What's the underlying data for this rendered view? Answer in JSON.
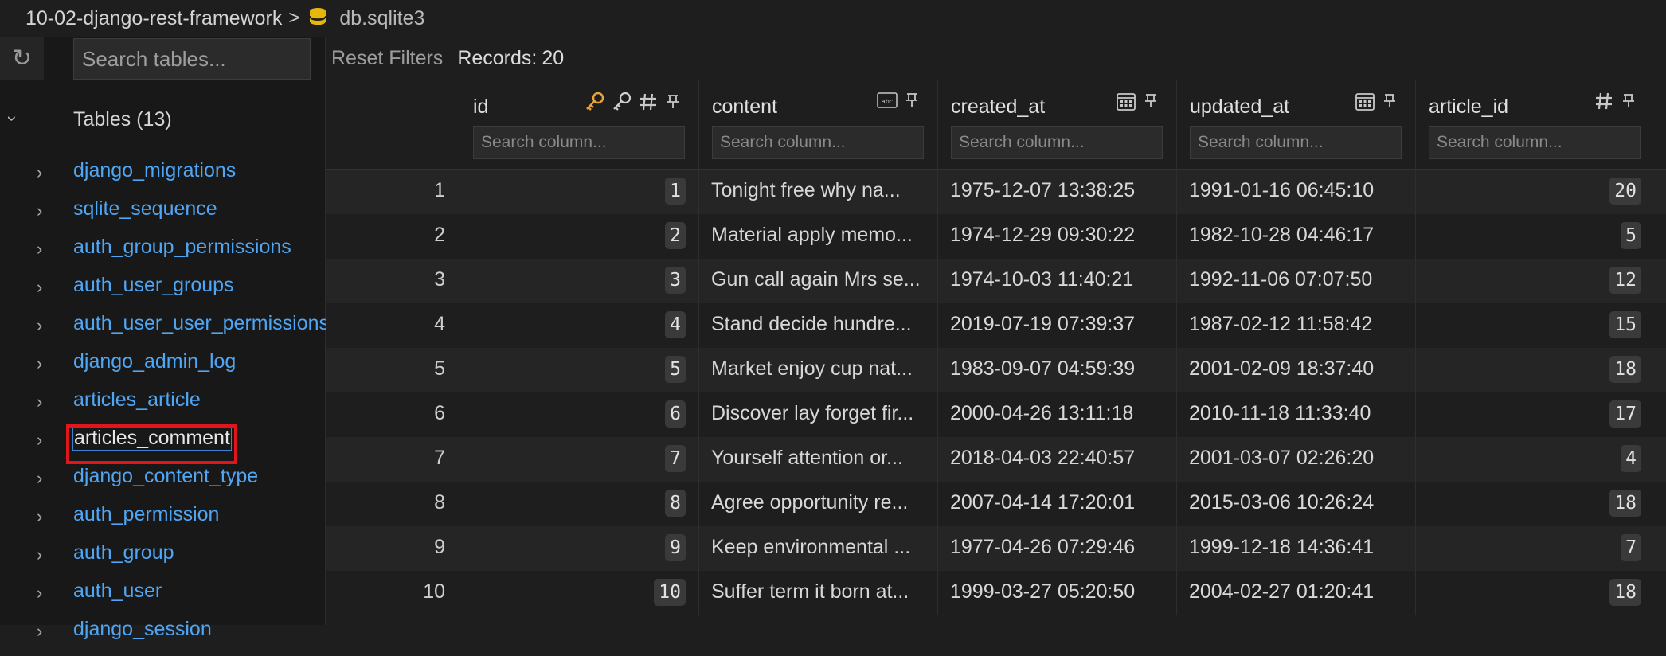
{
  "breadcrumb": {
    "folder": "10-02-django-rest-framework",
    "separator": ">",
    "file": "db.sqlite3",
    "db_icon_color": "#e5b80b"
  },
  "sidebar": {
    "refresh_icon": "↻",
    "search_placeholder": "Search tables...",
    "tables_label": "Tables (13)",
    "tables": [
      "django_migrations",
      "sqlite_sequence",
      "auth_group_permissions",
      "auth_user_groups",
      "auth_user_user_permissions",
      "django_admin_log",
      "articles_article",
      "articles_comment",
      "django_content_type",
      "auth_permission",
      "auth_group",
      "auth_user",
      "django_session"
    ],
    "selected": "articles_comment",
    "highlight_color": "#e0161b"
  },
  "toolbar": {
    "reset": "Reset Filters",
    "records_label": "Records:",
    "records_count": "20"
  },
  "columns": [
    {
      "name": "id",
      "icons": [
        "key-icon",
        "key-outline-icon",
        "hash-icon",
        "pin-icon"
      ]
    },
    {
      "name": "content",
      "icons": [
        "abc-icon",
        "pin-icon"
      ]
    },
    {
      "name": "created_at",
      "icons": [
        "calendar-icon",
        "pin-icon"
      ]
    },
    {
      "name": "updated_at",
      "icons": [
        "calendar-icon",
        "pin-icon"
      ]
    },
    {
      "name": "article_id",
      "icons": [
        "hash-icon",
        "pin-icon"
      ]
    }
  ],
  "column_search_placeholder": "Search column...",
  "rows": [
    {
      "n": "1",
      "id": "1",
      "content": "Tonight free why na...",
      "created_at": "1975-12-07 13:38:25",
      "updated_at": "1991-01-16 06:45:10",
      "article_id": "20"
    },
    {
      "n": "2",
      "id": "2",
      "content": "Material apply memo...",
      "created_at": "1974-12-29 09:30:22",
      "updated_at": "1982-10-28 04:46:17",
      "article_id": "5"
    },
    {
      "n": "3",
      "id": "3",
      "content": "Gun call again Mrs se...",
      "created_at": "1974-10-03 11:40:21",
      "updated_at": "1992-11-06 07:07:50",
      "article_id": "12"
    },
    {
      "n": "4",
      "id": "4",
      "content": "Stand decide hundre...",
      "created_at": "2019-07-19 07:39:37",
      "updated_at": "1987-02-12 11:58:42",
      "article_id": "15"
    },
    {
      "n": "5",
      "id": "5",
      "content": "Market enjoy cup nat...",
      "created_at": "1983-09-07 04:59:39",
      "updated_at": "2001-02-09 18:37:40",
      "article_id": "18"
    },
    {
      "n": "6",
      "id": "6",
      "content": "Discover lay forget fir...",
      "created_at": "2000-04-26 13:11:18",
      "updated_at": "2010-11-18 11:33:40",
      "article_id": "17"
    },
    {
      "n": "7",
      "id": "7",
      "content": "Yourself attention or...",
      "created_at": "2018-04-03 22:40:57",
      "updated_at": "2001-03-07 02:26:20",
      "article_id": "4"
    },
    {
      "n": "8",
      "id": "8",
      "content": "Agree opportunity re...",
      "created_at": "2007-04-14 17:20:01",
      "updated_at": "2015-03-06 10:26:24",
      "article_id": "18"
    },
    {
      "n": "9",
      "id": "9",
      "content": "Keep environmental ...",
      "created_at": "1977-04-26 07:29:46",
      "updated_at": "1999-12-18 14:36:41",
      "article_id": "7"
    },
    {
      "n": "10",
      "id": "10",
      "content": "Suffer term it born at...",
      "created_at": "1999-03-27 05:20:50",
      "updated_at": "2004-02-27 01:20:41",
      "article_id": "18"
    }
  ],
  "colors": {
    "link": "#4fa6f5",
    "key_icon": "#e8a33c"
  }
}
